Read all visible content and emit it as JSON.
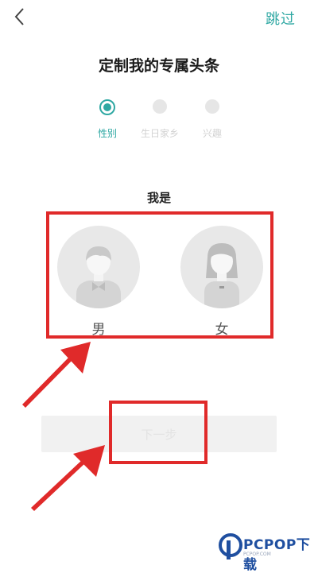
{
  "header": {
    "skip_label": "跳过"
  },
  "page_title": "定制我的专属头条",
  "steps": [
    {
      "label": "性别",
      "active": true
    },
    {
      "label": "生日家乡",
      "active": false
    },
    {
      "label": "兴趣",
      "active": false
    }
  ],
  "question": "我是",
  "genders": [
    {
      "label": "男",
      "icon": "male-avatar-icon"
    },
    {
      "label": "女",
      "icon": "female-avatar-icon"
    }
  ],
  "next_label": "下一步",
  "watermark": {
    "brand": "PCPOP下载",
    "sub": "PCPOP.COM"
  },
  "colors": {
    "accent": "#2fa8a3",
    "annotation": "#e02a2a",
    "avatar_bg": "#e8e8e8"
  }
}
